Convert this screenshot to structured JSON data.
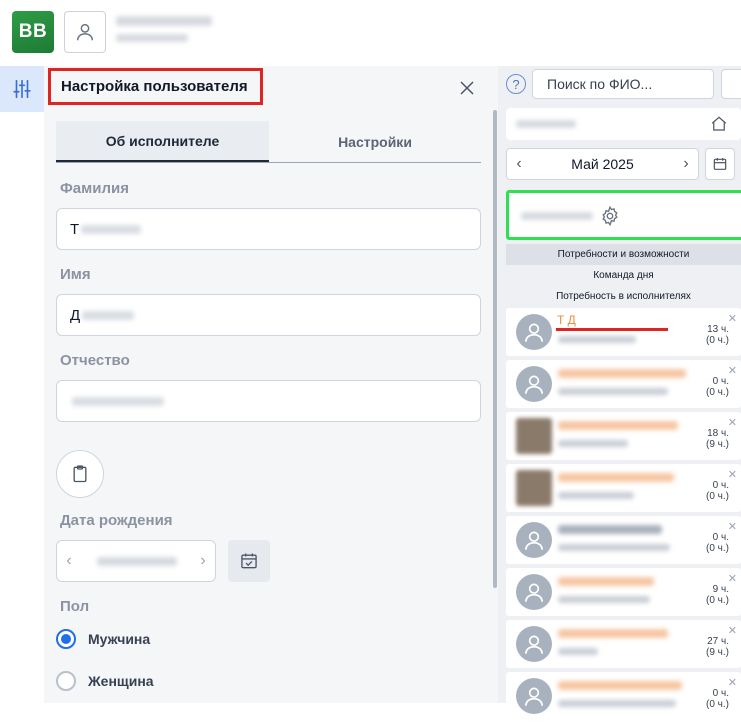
{
  "app": {
    "logo_text": "BB"
  },
  "panel": {
    "title": "Настройка пользователя",
    "tabs": [
      {
        "label": "Об исполнителе",
        "active": true
      },
      {
        "label": "Настройки",
        "active": false
      }
    ],
    "fields": {
      "lastname": {
        "label": "Фамилия",
        "value_initial": "Т"
      },
      "firstname": {
        "label": "Имя",
        "value_initial": "Д"
      },
      "patronymic": {
        "label": "Отчество",
        "value_initial": ""
      }
    },
    "birth_date": {
      "label": "Дата рождения",
      "value": ""
    },
    "gender": {
      "label": "Пол",
      "options": [
        {
          "label": "Мужчина",
          "selected": true
        },
        {
          "label": "Женщина",
          "selected": false
        }
      ]
    }
  },
  "right": {
    "search_placeholder": "Поиск по ФИО...",
    "month": "Май 2025",
    "menu": [
      "Потребности и возможности",
      "Команда дня",
      "Потребность в исполнителях"
    ],
    "first_card_initials": "Т          Д",
    "cards": [
      {
        "hours": "13 ч.",
        "sub_hours": "(0 ч.)",
        "highlighted": true
      },
      {
        "hours": "0 ч.",
        "sub_hours": "(0 ч.)"
      },
      {
        "hours": "18 ч.",
        "sub_hours": "(9 ч.)",
        "photo": true
      },
      {
        "hours": "0 ч.",
        "sub_hours": "(0 ч.)",
        "photo": true
      },
      {
        "hours": "0 ч.",
        "sub_hours": "(0 ч.)"
      },
      {
        "hours": "9 ч.",
        "sub_hours": "(0 ч.)"
      },
      {
        "hours": "27 ч.",
        "sub_hours": "(9 ч.)"
      },
      {
        "hours": "0 ч.",
        "sub_hours": "(0 ч.)"
      }
    ]
  },
  "colors": {
    "accent": "#1f6fe5",
    "title_outline": "#e02424",
    "green_outline": "#2fe050",
    "name_orange": "#f08a3c",
    "logo": "#2e9d46"
  },
  "icons": {
    "settings": "sliders-icon",
    "avatar": "user-icon",
    "close": "close-icon",
    "clipboard": "clipboard-icon",
    "calendar": "calendar-check-icon",
    "home": "home-icon",
    "gear": "gear-icon"
  }
}
